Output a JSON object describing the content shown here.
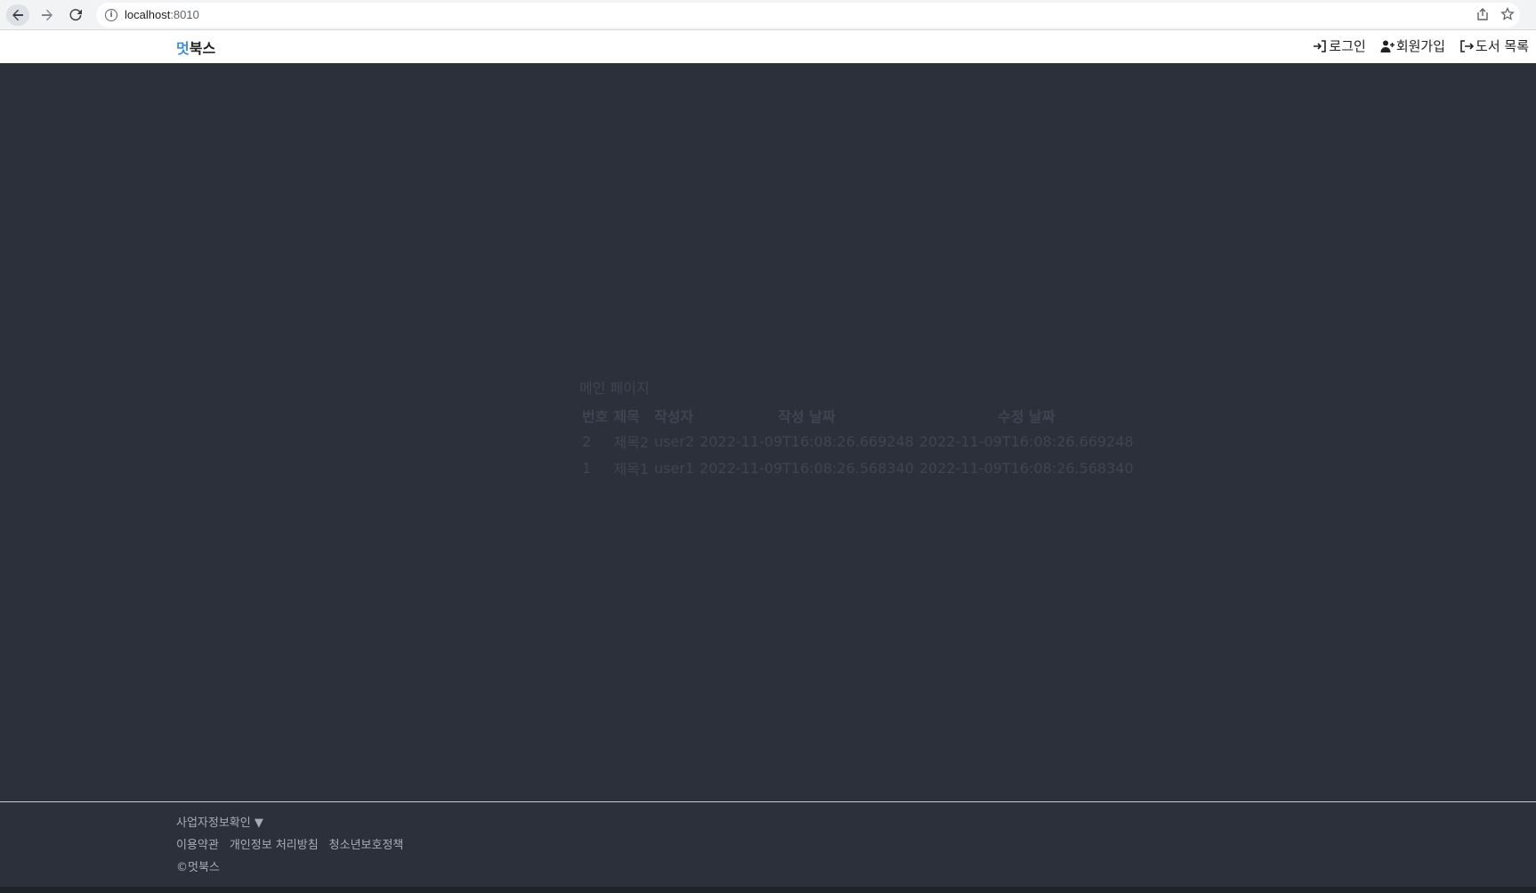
{
  "browser": {
    "url_host": "localhost",
    "url_port": ":8010"
  },
  "header": {
    "logo_accent": "멋",
    "logo_rest": "북스",
    "nav": {
      "login": "로그인",
      "signup": "회원가입",
      "books": "도서 목록"
    }
  },
  "main": {
    "heading": "메인 페이지",
    "columns": [
      "번호",
      "제목",
      "작성자",
      "작성 날짜",
      "수정 날짜"
    ],
    "rows": [
      [
        "2",
        "제목2",
        "user2",
        "2022-11-09T16:08:26.669248",
        "2022-11-09T16:08:26.669248"
      ],
      [
        "1",
        "제목1",
        "user1",
        "2022-11-09T16:08:26.568340",
        "2022-11-09T16:08:26.568340"
      ]
    ]
  },
  "footer": {
    "business_info": "사업자정보확인 ▼",
    "links": [
      "이용약관",
      "개인정보 처리방침",
      "청소년보호정책"
    ],
    "copyright": "©멋북스"
  },
  "colors": {
    "page_bg": "#2b303b",
    "accent": "#3b8fe8",
    "table_text": "#3e4552",
    "footer_text": "#a7adb6"
  }
}
